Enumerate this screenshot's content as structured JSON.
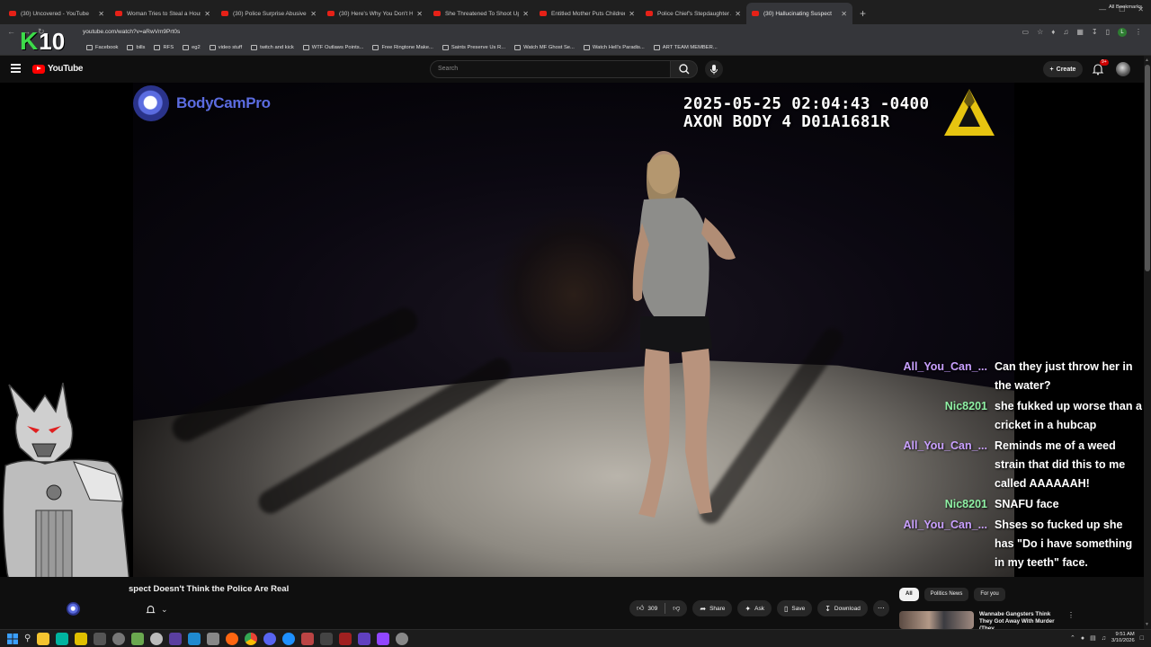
{
  "browser": {
    "tabs": [
      {
        "title": "(30) Uncovered - YouTube",
        "active": false
      },
      {
        "title": "Woman Tries to Steal a House",
        "active": false
      },
      {
        "title": "(30) Police Surprise Abusive Gi",
        "active": false
      },
      {
        "title": "(30) Here's Why You Don't Hel",
        "active": false
      },
      {
        "title": "She Threatened To Shoot Up S",
        "active": false
      },
      {
        "title": "Entitled Mother Puts Children",
        "active": false
      },
      {
        "title": "Police Chief's Stepdaughter Arr",
        "active": false
      },
      {
        "title": "(30) Hallucinating Suspect",
        "active": true
      }
    ],
    "new_tab": "+",
    "url": "youtube.com/watch?v=aRwVm9Prt0s",
    "profile_letter": "L",
    "bookmarks": [
      "Facebook",
      "bills",
      "RFS",
      "eg2",
      "video stuff",
      "twitch and kick",
      "WTF Outlaws Points...",
      "Free Ringtone Make...",
      "Saints Preserve Us R...",
      "Watch MF Ghost Se...",
      "Watch Hell's Paradis...",
      "ART TEAM MEMBER..."
    ],
    "all_bookmarks": "All Bookmarks"
  },
  "overlay_logo": {
    "letter": "K",
    "number": "10"
  },
  "youtube": {
    "logo_text": "YouTube",
    "search_placeholder": "Search",
    "create_label": "Create",
    "notif_count": "9+"
  },
  "video": {
    "brand": "BodyCamPro",
    "timestamp": "2025-05-25 02:04:43 -0400",
    "device": "AXON BODY 4 D01A1681R"
  },
  "chat": [
    {
      "user": "All_You_Can_...",
      "color": "#c9a0ff",
      "text": "Can they just throw her in the water?"
    },
    {
      "user": "Nic8201",
      "color": "#8ff0a4",
      "text": "she fukked up worse than a cricket in a hubcap"
    },
    {
      "user": "All_You_Can_...",
      "color": "#c9a0ff",
      "text": "Reminds me of a weed strain that did this to me called AAAAAAH!"
    },
    {
      "user": "Nic8201",
      "color": "#8ff0a4",
      "text": "SNAFU face"
    },
    {
      "user": "All_You_Can_...",
      "color": "#c9a0ff",
      "text": "Shses so fucked up she has \"Do i have something in my teeth\" face."
    }
  ],
  "below_video": {
    "title": "spect Doesn't Think the Police Are Real",
    "likes": "309",
    "share": "Share",
    "ask": "Ask",
    "save": "Save",
    "download": "Download",
    "chips": [
      "All",
      "Politics News",
      "For you"
    ],
    "rec_title": "Wannabe Gangsters Think They Got Away With Murder (They ..."
  },
  "taskbar": {
    "time": "9:51 AM",
    "date": "3/10/2026"
  }
}
